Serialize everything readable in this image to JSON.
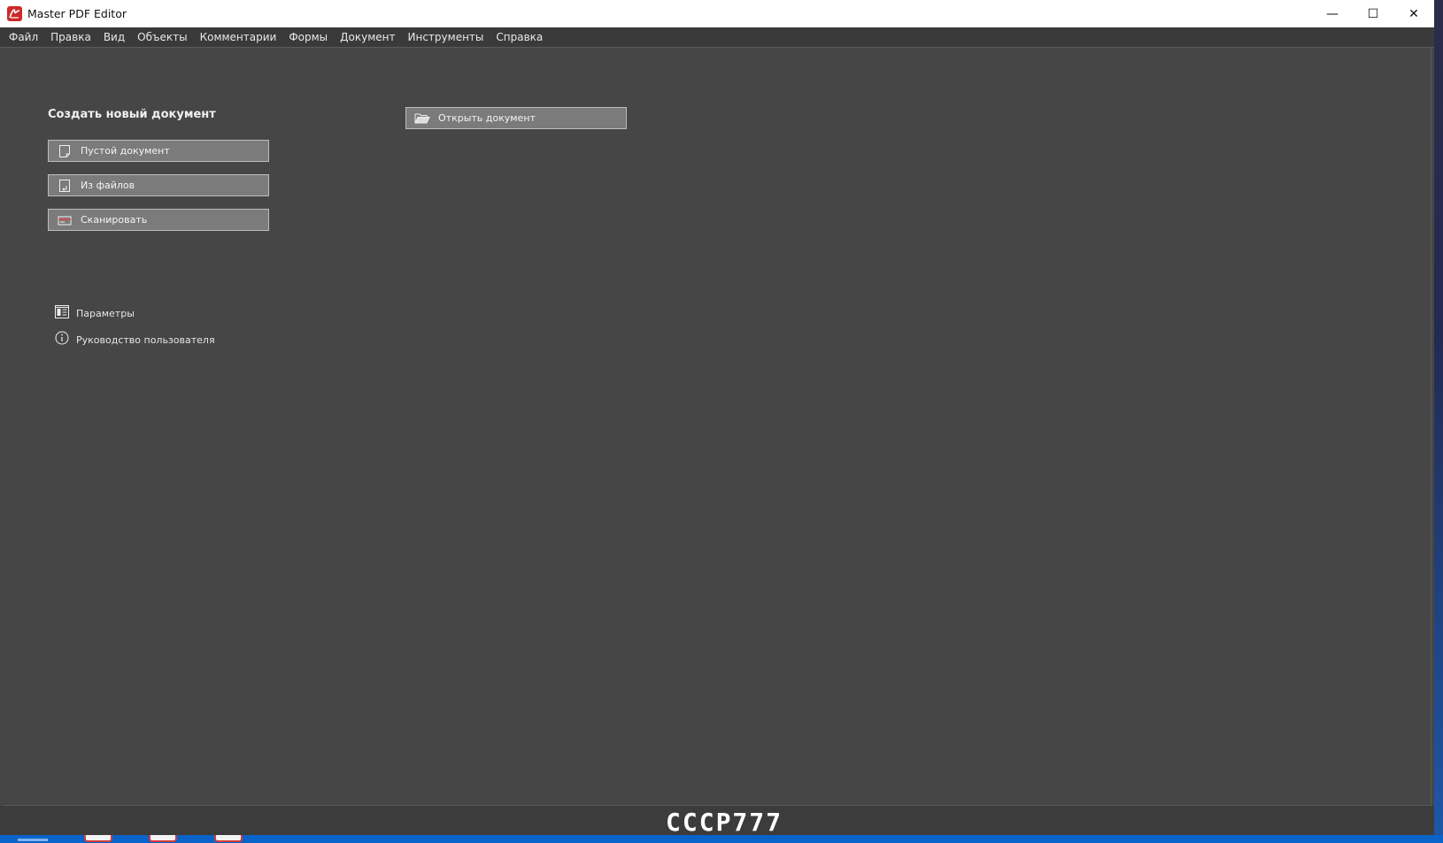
{
  "window": {
    "title": "Master PDF Editor",
    "controls": {
      "minimize": "—",
      "maximize": "☐",
      "close": "✕"
    }
  },
  "menu": [
    "Файл",
    "Правка",
    "Вид",
    "Объекты",
    "Комментарии",
    "Формы",
    "Документ",
    "Инструменты",
    "Справка"
  ],
  "start_page": {
    "create_title": "Создать новый документ",
    "create_buttons": {
      "blank": "Пустой документ",
      "from_files": "Из файлов",
      "scan": "Сканировать"
    },
    "open_button": "Открыть документ",
    "links": {
      "settings": "Параметры",
      "user_guide": "Руководство пользователя"
    }
  },
  "watermark": "CCCP777",
  "colors": {
    "background": "#464646",
    "button": "#7b7b7b",
    "logo": "#cc2a2a",
    "taskbar": "#0a63c9"
  },
  "icons": {
    "app": "master-pdf-logo",
    "blank": "blank-page-icon",
    "from_files": "page-import-icon",
    "scan": "scanner-icon",
    "open": "folder-open-icon",
    "settings": "settings-panel-icon",
    "info": "info-icon"
  }
}
